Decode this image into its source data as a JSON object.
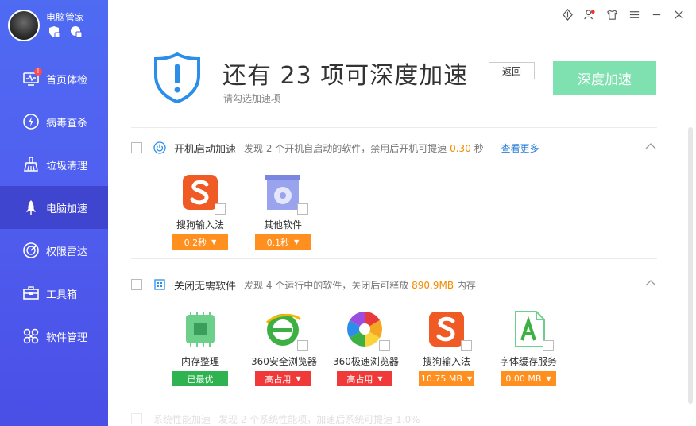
{
  "app": {
    "name": "电脑管家"
  },
  "sidebar": {
    "items": [
      {
        "label": "首页体检",
        "icon": "monitor-icon",
        "badge": "!"
      },
      {
        "label": "病毒查杀",
        "icon": "lightning-icon"
      },
      {
        "label": "垃圾清理",
        "icon": "broom-icon"
      },
      {
        "label": "电脑加速",
        "icon": "rocket-icon",
        "active": true
      },
      {
        "label": "权限雷达",
        "icon": "radar-icon"
      },
      {
        "label": "工具箱",
        "icon": "toolbox-icon"
      },
      {
        "label": "软件管理",
        "icon": "software-icon"
      }
    ]
  },
  "hero": {
    "headline": "还有 23 项可深度加速",
    "subhead": "请勾选加速项",
    "back_label": "返回",
    "deep_label": "深度加速",
    "accent": "#7fe0b0"
  },
  "sections": [
    {
      "title": "开机启动加速",
      "desc_prefix": "发现 2 个开机自启动的软件，禁用后开机可提速",
      "highlight": "0.30",
      "desc_suffix": "秒",
      "more": "查看更多",
      "apps": [
        {
          "name": "搜狗输入法",
          "tag": "0.2秒",
          "style": "orange",
          "dropdown": true,
          "icon": "sogou-icon"
        },
        {
          "name": "其他软件",
          "tag": "0.1秒",
          "style": "orange",
          "dropdown": true,
          "icon": "software-box-icon"
        }
      ]
    },
    {
      "title": "关闭无需软件",
      "desc_prefix": "发现 4 个运行中的软件，关闭后可释放",
      "highlight": "890.9MB",
      "desc_suffix": "内存",
      "apps": [
        {
          "name": "内存整理",
          "tag": "已最优",
          "style": "green",
          "dropdown": false,
          "icon": "memory-chip-icon"
        },
        {
          "name": "360安全浏览器",
          "tag": "高占用",
          "style": "red",
          "dropdown": true,
          "icon": "browser-360-safe-icon"
        },
        {
          "name": "360极速浏览器",
          "tag": "高占用",
          "style": "red",
          "dropdown": true,
          "icon": "browser-360-speed-icon"
        },
        {
          "name": "搜狗输入法",
          "tag": "10.75 MB",
          "style": "orange",
          "dropdown": true,
          "icon": "sogou-icon"
        },
        {
          "name": "字体缓存服务",
          "tag": "0.00 MB",
          "style": "orange",
          "dropdown": true,
          "icon": "font-cache-icon"
        }
      ]
    }
  ],
  "faded_section": {
    "title": "系统性能加速",
    "desc": "发现 2 个系统性能项，加速后系统可提速 1.0%"
  }
}
